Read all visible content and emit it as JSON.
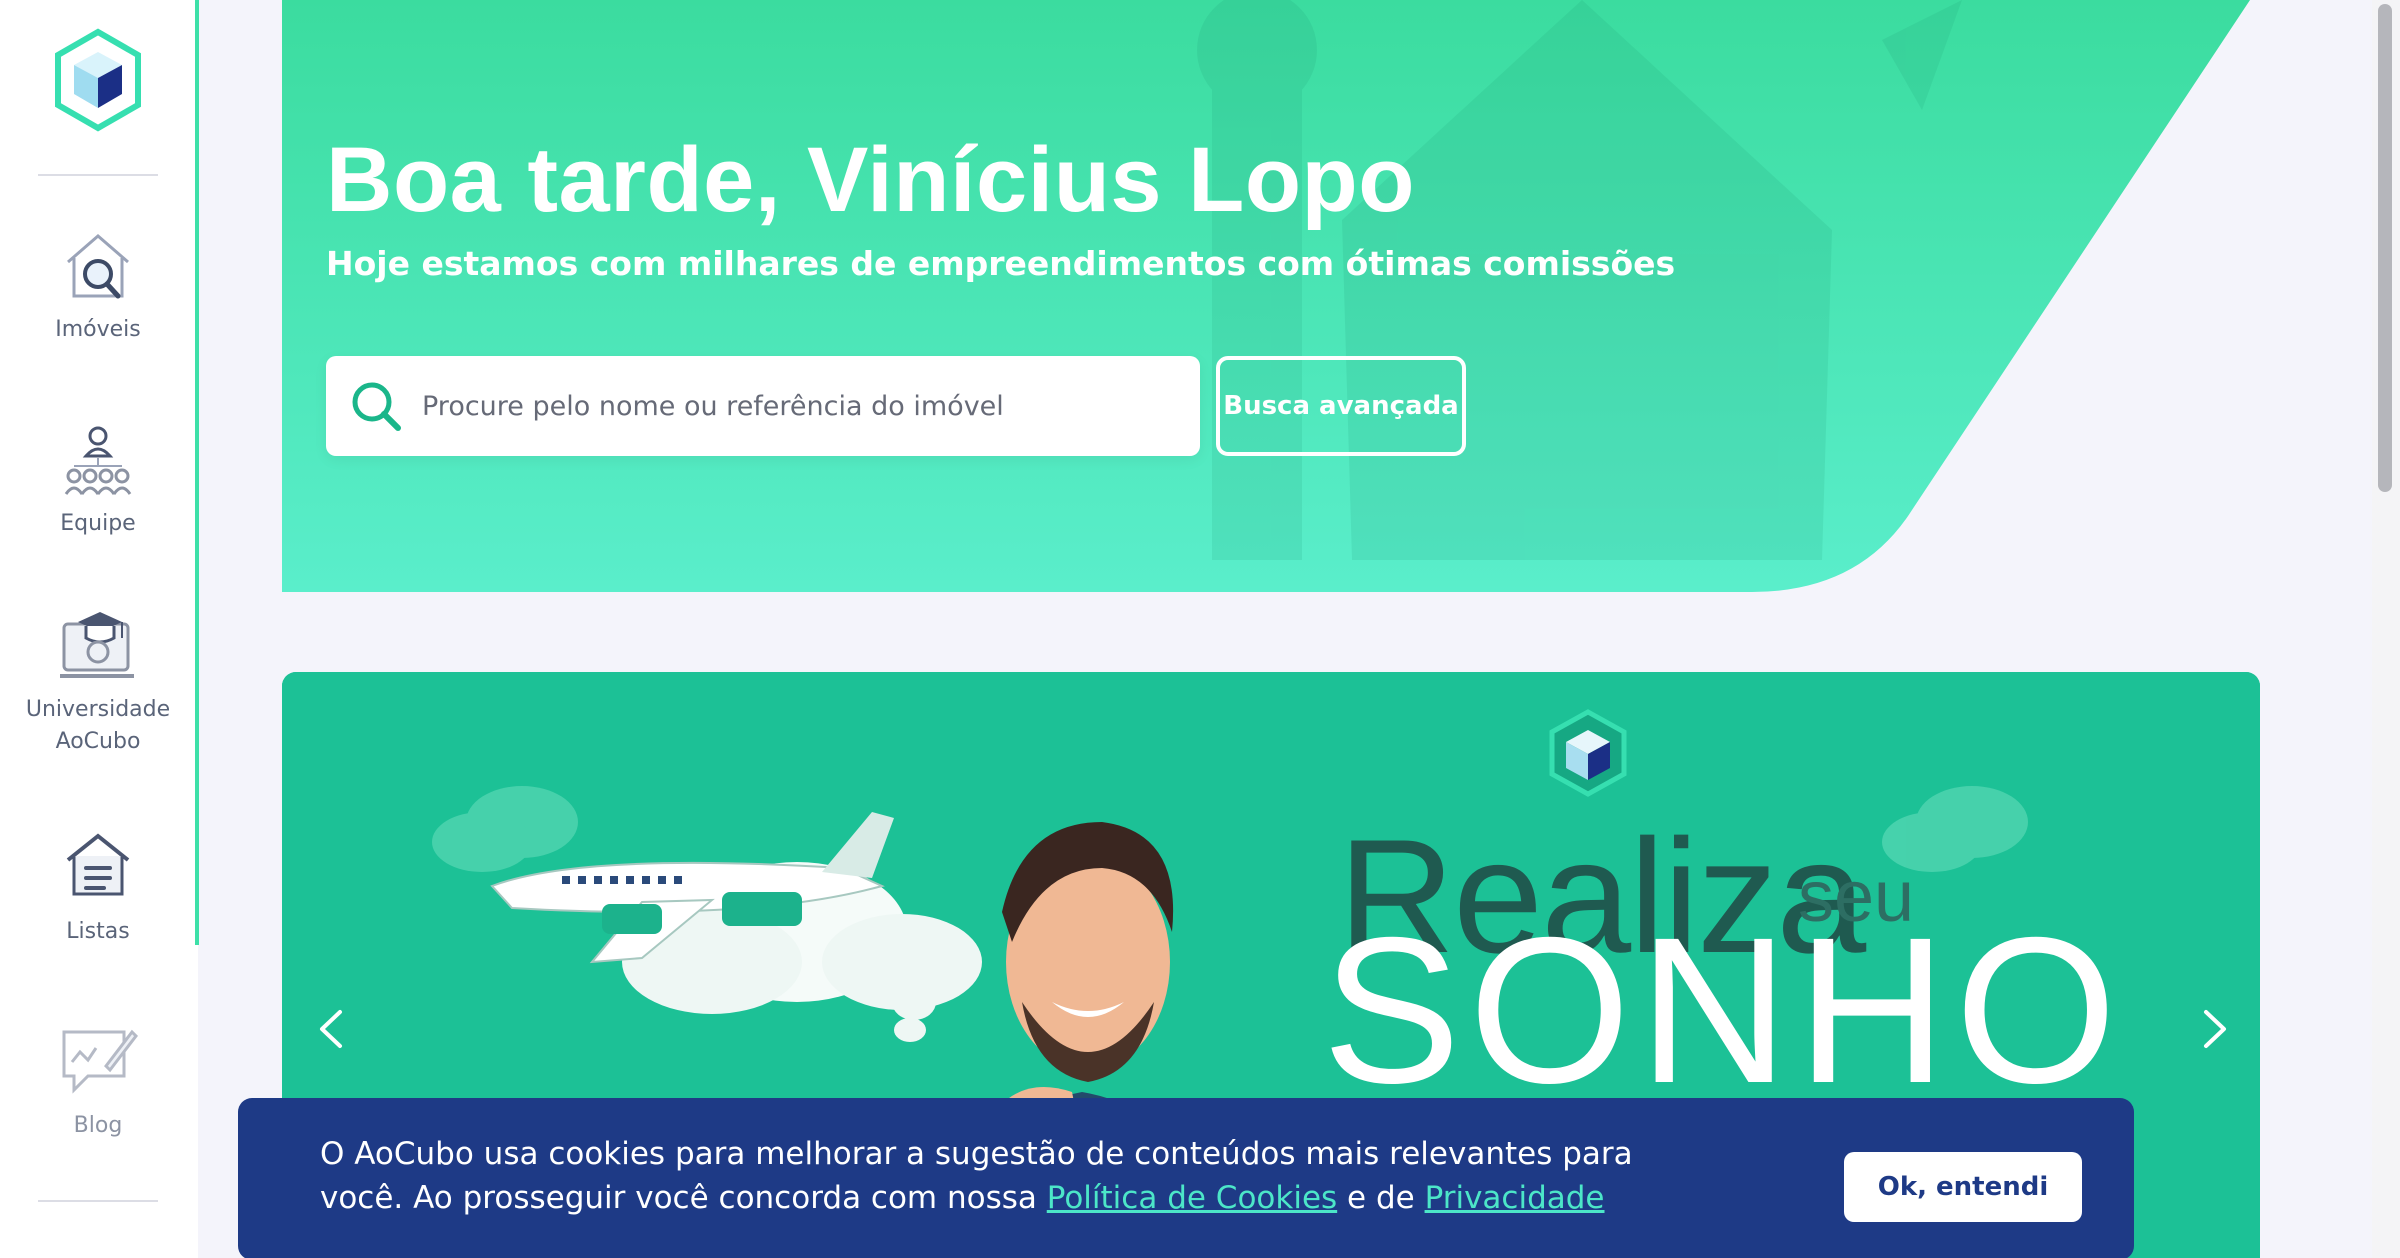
{
  "sidebar": {
    "logo_icon": "aocubo-cube-logo",
    "items": [
      {
        "label": "Imóveis",
        "icon": "house-search-icon"
      },
      {
        "label": "Equipe",
        "icon": "team-hierarchy-icon"
      },
      {
        "label": "Universidade AoCubo",
        "icon": "graduation-computer-icon"
      },
      {
        "label": "Listas",
        "icon": "house-list-icon"
      },
      {
        "label": "Blog",
        "icon": "chat-pencil-icon"
      }
    ]
  },
  "hero": {
    "title": "Boa tarde, Vinícius Lopo",
    "subtitle": "Hoje estamos com milhares de empreendimentos com ótimas comissões",
    "search_placeholder": "Procure pelo nome ou referência do imóvel",
    "advanced_search_label": "Busca avançada"
  },
  "banner": {
    "word_1": "Realiza",
    "word_2": "seu",
    "word_3": "SONHO",
    "prev_icon": "chevron-left-icon",
    "next_icon": "chevron-right-icon"
  },
  "cookie": {
    "text_before": "O AoCubo usa cookies para melhorar a sugestão de conteúdos mais relevantes para você. Ao prosseguir você concorda com nossa ",
    "cookies_link": "Política de Cookies",
    "text_middle": " e de ",
    "privacy_link": "Privacidade",
    "button_label": "Ok, entendi"
  },
  "colors": {
    "accent_green": "#3de0a8",
    "cookie_blue": "#1e3a86",
    "link_teal": "#4ce6c8"
  }
}
